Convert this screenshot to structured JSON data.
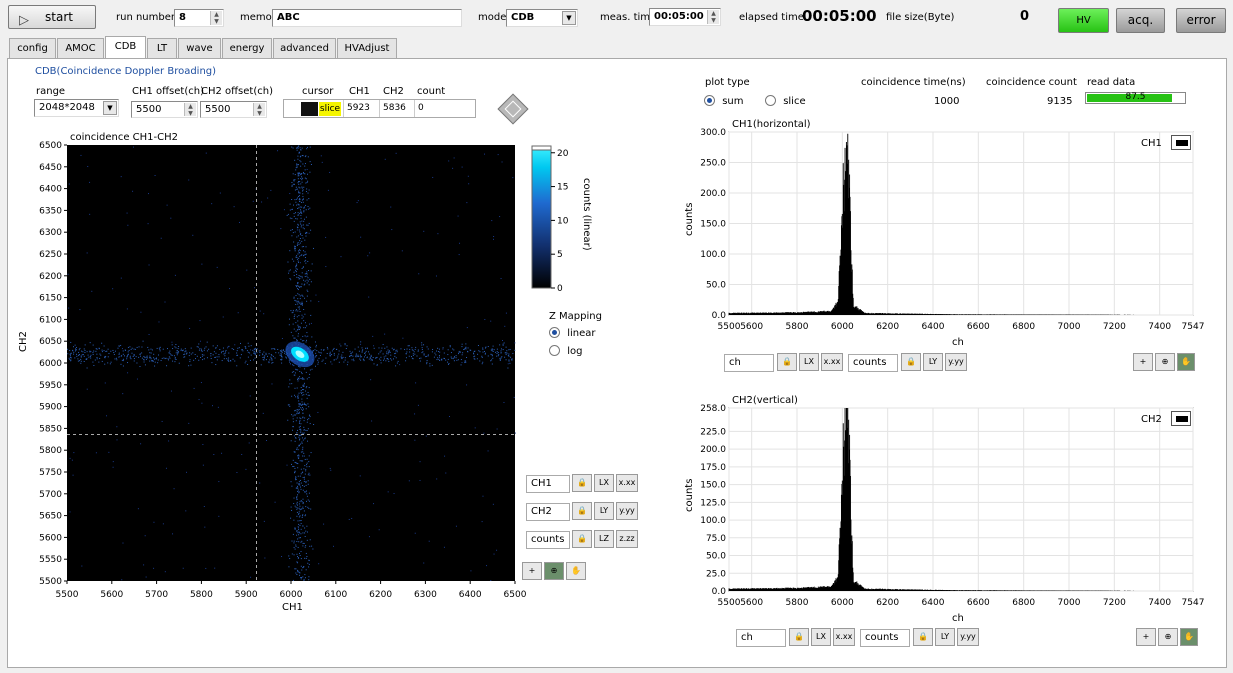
{
  "toolbar": {
    "start_label": "start",
    "run_number_label": "run number",
    "run_number": "8",
    "memo_label": "memo",
    "memo": "ABC",
    "mode_label": "mode",
    "mode": "CDB",
    "meas_time_label": "meas. time",
    "meas_time": "00:05:00",
    "elapsed_label": "elapsed time",
    "elapsed": "00:05:00",
    "filesize_label": "file size(Byte)",
    "filesize": "0",
    "hv_label": "HV",
    "acq_label": "acq.",
    "error_label": "error"
  },
  "tabs": [
    "config",
    "AMOC",
    "CDB",
    "LT",
    "wave",
    "energy",
    "advanced",
    "HVAdjust"
  ],
  "active_tab": "CDB",
  "cdb": {
    "title": "CDB(Coincidence Doppler Broading)",
    "range_label": "range",
    "range_value": "2048*2048",
    "ch1_offset_label": "CH1 offset(ch)",
    "ch2_offset_label": "CH2 offset(ch)",
    "ch1_offset": "5500",
    "ch2_offset": "5500",
    "cursor_label": "cursor",
    "cursor_name": "slice",
    "ch1_label": "CH1",
    "ch2_label": "CH2",
    "count_label": "count",
    "cursor_ch1": "5923",
    "cursor_ch2": "5836",
    "cursor_count": "0",
    "zmap_label": "Z Mapping",
    "zmap_linear": "linear",
    "zmap_log": "log",
    "zmap_selected": "linear",
    "legend_ch1": "CH1",
    "legend_ch2": "CH2",
    "legend_counts": "counts"
  },
  "right": {
    "plot_type_label": "plot type",
    "sum_label": "sum",
    "slice_label": "slice",
    "plot_type_selected": "sum",
    "coinc_time_label": "coincidence  time(ns)",
    "coinc_time": "1000",
    "coinc_count_label": "coincidence count",
    "coinc_count": "9135",
    "read_data_label": "read data",
    "read_data_value": 87.5,
    "read_data_text": "87.5",
    "ch_label": "ch",
    "counts_label": "counts"
  },
  "chart_data": [
    {
      "type": "heatmap",
      "title": "coincidence CH1-CH2",
      "xlabel": "CH1",
      "ylabel": "CH2",
      "xlim": [
        5500,
        6500
      ],
      "ylim": [
        5500,
        6500
      ],
      "xticks": [
        5500,
        5600,
        5700,
        5800,
        5900,
        6000,
        6100,
        6200,
        6300,
        6400,
        6500
      ],
      "yticks": [
        5500,
        5550,
        5600,
        5650,
        5700,
        5750,
        5800,
        5850,
        5900,
        5950,
        6000,
        6050,
        6100,
        6150,
        6200,
        6250,
        6300,
        6350,
        6400,
        6450,
        6500
      ],
      "peak": {
        "x": 6020,
        "y": 6020
      },
      "cursor": {
        "x": 5923,
        "y": 5836
      },
      "colorbar": {
        "label": "counts (linear)",
        "ticks": [
          0,
          5,
          10,
          15,
          20
        ],
        "range": [
          0,
          21
        ]
      },
      "colors": {
        "background": "#000000",
        "low": "#1a3a8a",
        "high": "#00e0ff"
      }
    },
    {
      "type": "bar",
      "title": "CH1(horizontal)",
      "legend": "CH1",
      "xlabel": "ch",
      "ylabel": "counts",
      "xlim": [
        5500,
        7547
      ],
      "ylim": [
        0,
        300
      ],
      "xticks": [
        5500,
        5600,
        5800,
        6000,
        6200,
        6400,
        6600,
        6800,
        7000,
        7200,
        7400,
        7547
      ],
      "yticks": [
        0,
        50,
        100,
        150,
        200,
        250,
        300
      ],
      "ytick_labels": [
        "0.0",
        "50.0",
        "100.0",
        "150.0",
        "200.0",
        "250.0",
        "300.0"
      ],
      "peak": {
        "x": 6022,
        "y": 278
      },
      "series": [
        {
          "x": [
            5500,
            5800,
            5950,
            5980,
            5995,
            6005,
            6012,
            6018,
            6022,
            6030,
            6040,
            6050,
            6100,
            6500,
            7547
          ],
          "y": [
            3,
            4,
            6,
            20,
            120,
            210,
            245,
            260,
            278,
            230,
            90,
            15,
            3,
            1,
            0
          ]
        }
      ]
    },
    {
      "type": "bar",
      "title": "CH2(vertical)",
      "legend": "CH2",
      "xlabel": "ch",
      "ylabel": "counts",
      "xlim": [
        5500,
        7547
      ],
      "ylim": [
        0,
        258
      ],
      "xticks": [
        5500,
        5600,
        5800,
        6000,
        6200,
        6400,
        6600,
        6800,
        7000,
        7200,
        7400,
        7547
      ],
      "yticks": [
        0,
        25,
        50,
        75,
        100,
        125,
        150,
        175,
        200,
        225,
        258
      ],
      "ytick_labels": [
        "0.0",
        "25.0",
        "50.0",
        "75.0",
        "100.0",
        "125.0",
        "150.0",
        "175.0",
        "200.0",
        "225.0",
        "258.0"
      ],
      "peak": {
        "x": 6022,
        "y": 258
      },
      "series": [
        {
          "x": [
            5500,
            5800,
            5950,
            5980,
            5995,
            6005,
            6012,
            6018,
            6022,
            6030,
            6040,
            6050,
            6100,
            6500,
            7547
          ],
          "y": [
            3,
            4,
            6,
            18,
            110,
            200,
            235,
            250,
            258,
            220,
            85,
            14,
            3,
            1,
            0
          ]
        }
      ]
    }
  ]
}
